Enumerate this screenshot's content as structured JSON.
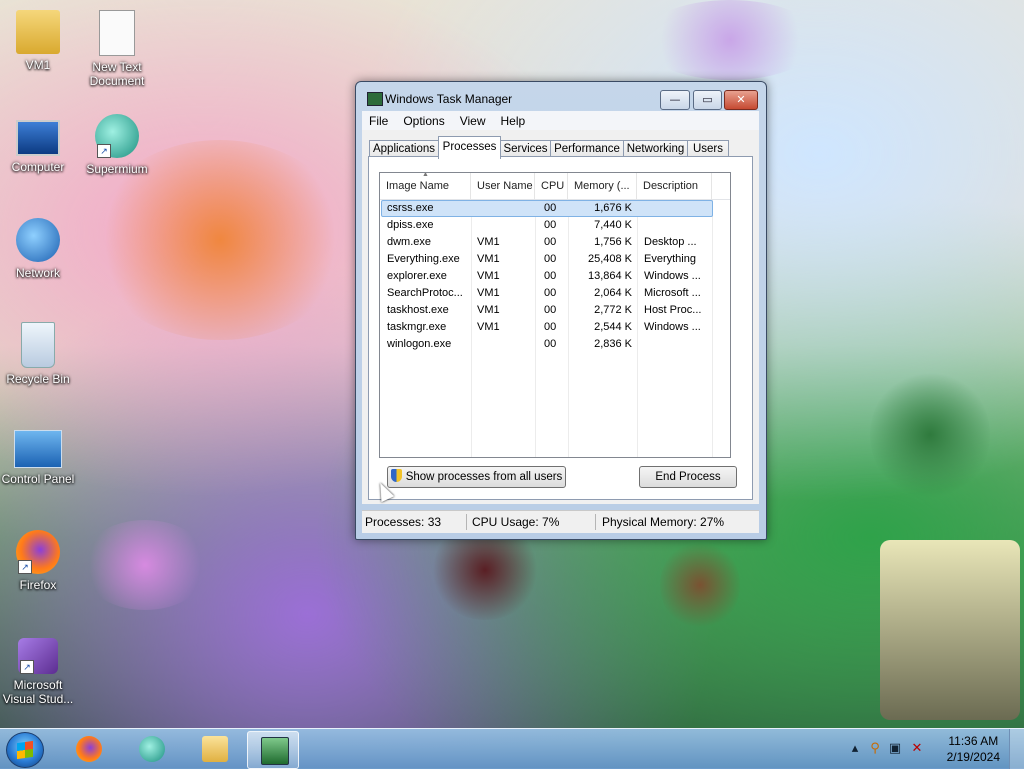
{
  "desktop": {
    "icons": [
      {
        "label": "VM1",
        "icon": "user-folder-icon"
      },
      {
        "label": "New Text Document",
        "icon": "text-document-icon"
      },
      {
        "label": "Computer",
        "icon": "computer-icon"
      },
      {
        "label": "Supermium",
        "icon": "supermium-icon"
      },
      {
        "label": "Network",
        "icon": "network-icon"
      },
      {
        "label": "Recycle Bin",
        "icon": "recycle-bin-icon"
      },
      {
        "label": "Control Panel",
        "icon": "control-panel-icon"
      },
      {
        "label": "Firefox",
        "icon": "firefox-icon"
      },
      {
        "label": "Microsoft Visual Stud...",
        "icon": "visual-studio-icon"
      }
    ]
  },
  "window": {
    "title": "Windows Task Manager",
    "min_glyph": "—",
    "max_glyph": "▭",
    "close_glyph": "✕",
    "menu": [
      "File",
      "Options",
      "View",
      "Help"
    ],
    "tabs": [
      "Applications",
      "Processes",
      "Services",
      "Performance",
      "Networking",
      "Users"
    ],
    "active_tab": "Processes",
    "columns": [
      "Image Name",
      "User Name",
      "CPU",
      "Memory (...",
      "Description"
    ],
    "sort_arrow": "▲",
    "processes": [
      {
        "name": "csrss.exe",
        "user": "",
        "cpu": "00",
        "memory": "1,676 K",
        "description": ""
      },
      {
        "name": "dpiss.exe",
        "user": "",
        "cpu": "00",
        "memory": "7,440 K",
        "description": ""
      },
      {
        "name": "dwm.exe",
        "user": "VM1",
        "cpu": "00",
        "memory": "1,756 K",
        "description": "Desktop ..."
      },
      {
        "name": "Everything.exe",
        "user": "VM1",
        "cpu": "00",
        "memory": "25,408 K",
        "description": "Everything"
      },
      {
        "name": "explorer.exe",
        "user": "VM1",
        "cpu": "00",
        "memory": "13,864 K",
        "description": "Windows ..."
      },
      {
        "name": "SearchProtoc...",
        "user": "VM1",
        "cpu": "00",
        "memory": "2,064 K",
        "description": "Microsoft ..."
      },
      {
        "name": "taskhost.exe",
        "user": "VM1",
        "cpu": "00",
        "memory": "2,772 K",
        "description": "Host Proc..."
      },
      {
        "name": "taskmgr.exe",
        "user": "VM1",
        "cpu": "00",
        "memory": "2,544 K",
        "description": "Windows ..."
      },
      {
        "name": "winlogon.exe",
        "user": "",
        "cpu": "00",
        "memory": "2,836 K",
        "description": ""
      }
    ],
    "show_all_button": "Show processes from all users",
    "end_process_button": "End Process",
    "status": {
      "processes": "Processes: 33",
      "cpu": "CPU Usage: 7%",
      "memory": "Physical Memory: 27%"
    }
  },
  "taskbar": {
    "pinned": [
      "firefox-icon",
      "supermium-icon",
      "file-explorer-icon",
      "task-manager-icon"
    ],
    "tray_icons": [
      "show-hidden-icons-chevron",
      "search-icon",
      "network-icon",
      "volume-muted-icon"
    ],
    "clock_time": "11:36 AM",
    "clock_date": "2/19/2024"
  },
  "colors": {
    "selection": "#cfe3f8",
    "title_bar": "#c5d6ea",
    "close_button": "#c64a32"
  }
}
